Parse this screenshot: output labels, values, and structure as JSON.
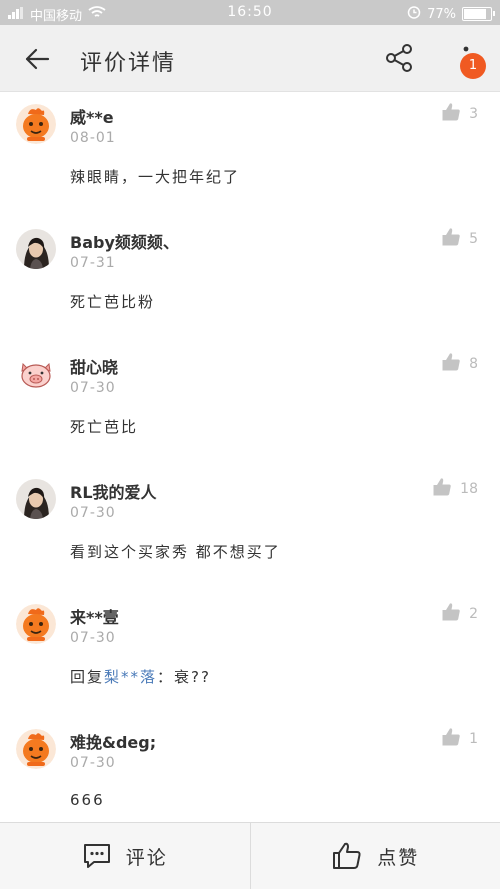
{
  "status_bar": {
    "carrier": "中国移动",
    "time": "16:50",
    "battery_percent": "77%",
    "battery_level": 0.77
  },
  "header": {
    "title": "评价详情",
    "badge": "1"
  },
  "comments": [
    {
      "username": "威**e",
      "date": "08-01",
      "content": "辣眼睛，一大把年纪了",
      "likes": "3",
      "avatar": "mascot-avatar"
    },
    {
      "username": "Baby颏颏颏、",
      "date": "07-31",
      "content": "死亡芭比粉",
      "likes": "5",
      "avatar": "photo-avatar"
    },
    {
      "username": "甜心晓",
      "date": "07-30",
      "content": "死亡芭比",
      "likes": "8",
      "avatar": "pig-avatar"
    },
    {
      "username": "RL我的爱人",
      "date": "07-30",
      "content": "看到这个买家秀 都不想买了",
      "likes": "18",
      "avatar": "photo-avatar"
    },
    {
      "username": "来**壹",
      "date": "07-30",
      "reply_prefix": "回复",
      "mention": "梨**落",
      "reply_text": "：衰??",
      "likes": "2",
      "avatar": "mascot-avatar"
    },
    {
      "username": "难挽&deg;",
      "date": "07-30",
      "content": "666",
      "likes": "1",
      "avatar": "mascot-avatar"
    }
  ],
  "bottom_bar": {
    "comment_label": "评论",
    "like_label": "点赞"
  },
  "colors": {
    "accent": "#f05a22",
    "mention": "#4a7ab8",
    "status_bar": "#c9c9c9"
  }
}
